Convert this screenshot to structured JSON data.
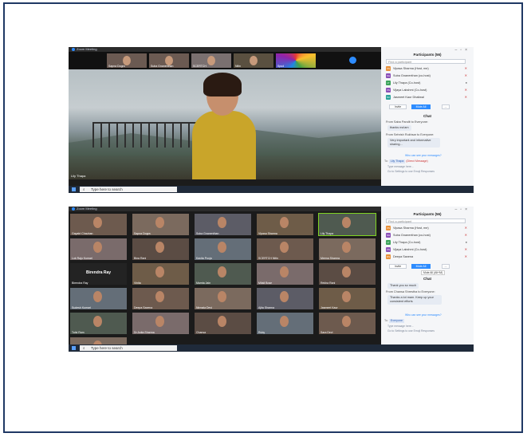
{
  "zoom_title": "Zoom Meeting",
  "taskbar": {
    "search_placeholder": "Type here to search"
  },
  "screenshot1": {
    "strip_labels": [
      "Sapna Dogra",
      "Suba Gnanenthan",
      "SCERTCH",
      "Nitin",
      "Spud"
    ],
    "speaker_label": "Lily Thapa",
    "participants_title": "Participants (56)",
    "find_placeholder": "Find a participant",
    "participants": [
      {
        "initials": "VS",
        "name": "Vipasa Sharma (Host, me)",
        "color": "#e8913a"
      },
      {
        "initials": "SG",
        "name": "Suba Gnanenthan (co-host)",
        "color": "#8a4fb8"
      },
      {
        "initials": "LT",
        "name": "Lily Thapa (Co-host)",
        "color": "#3aa35a"
      },
      {
        "initials": "VS",
        "name": "Vijaya Lakshmi (Co-host)",
        "color": "#8a4fb8"
      },
      {
        "initials": "SU",
        "name": "Jasmeet Kaur Dhaliwal",
        "color": "#2aa39a"
      }
    ],
    "buttons": {
      "invite": "Invite",
      "mute_all": "Mute All",
      "more": "..."
    },
    "chat_title": "Chat",
    "chat": [
      {
        "from": "From Saba Pandit to Everyone:",
        "text": "thanks ma'am"
      },
      {
        "from": "From Sehrish Rukhsar to Everyone:",
        "text": "Very important and informative sharing..."
      }
    ],
    "who_can_see": "Who can see your messages?",
    "to_label": "To:",
    "to_value": "Lily Thapa",
    "direct_message": "(Direct Message)",
    "input_hint": "Type message here...",
    "settings_hint": "Go to Settings to use Emoji Responses"
  },
  "screenshot2": {
    "participants_title": "Participants (56)",
    "find_placeholder": "Find a participant",
    "participants": [
      {
        "initials": "VS",
        "name": "Vipasa Sharma (Host, me)",
        "color": "#e8913a"
      },
      {
        "initials": "SG",
        "name": "Suba Gnanenthan (co-host)",
        "color": "#8a4fb8"
      },
      {
        "initials": "LT",
        "name": "Lily Thapa (Co-host)",
        "color": "#3aa35a"
      },
      {
        "initials": "VS",
        "name": "Vijaya Lakshmi (Co-host)",
        "color": "#8a4fb8"
      },
      {
        "initials": "DS",
        "name": "Deepa Saxena",
        "color": "#e8913a"
      }
    ],
    "buttons": {
      "invite": "Invite",
      "mute_all": "Mute All",
      "more": "..."
    },
    "mute_tooltip": "Mute All (Alt+M)",
    "chat_title": "Chat",
    "chat": [
      {
        "from": "",
        "text": "Thank you so much"
      },
      {
        "from": "From Chansa Shrestha to Everyone:",
        "text": "Thanks a lot mam. Keep up your consistent efforts"
      }
    ],
    "who_can_see": "Who can see your messages?",
    "to_label": "To:",
    "to_value": "Everyone",
    "input_hint": "Type message here...",
    "settings_hint": "Go to Settings to use Emoji Responses",
    "tiles": [
      {
        "name": "Gayatri Chauhan",
        "kind": "video"
      },
      {
        "name": "Sapna Dogra",
        "kind": "video"
      },
      {
        "name": "Suba Gnanenthan",
        "kind": "video"
      },
      {
        "name": "Vipasa Sharma",
        "kind": "video"
      },
      {
        "name": "Lily Thapa",
        "kind": "video",
        "active": true
      },
      {
        "name": "Lok Raju Kumari",
        "kind": "video"
      },
      {
        "name": "Bina Rani",
        "kind": "video"
      },
      {
        "name": "Kavita Pooja",
        "kind": "video"
      },
      {
        "name": "SCERTCH Nitin",
        "kind": "video"
      },
      {
        "name": "Meena Sharma",
        "kind": "video"
      },
      {
        "name": "Birendra Ray",
        "kind": "name"
      },
      {
        "name": "Vinita",
        "kind": "video"
      },
      {
        "name": "Mamta Jain",
        "kind": "video"
      },
      {
        "name": "Mitali Bose",
        "kind": "video"
      },
      {
        "name": "Rekha Rani",
        "kind": "video"
      },
      {
        "name": "Sudesh Kumari",
        "kind": "video"
      },
      {
        "name": "Deepa Saxena",
        "kind": "video"
      },
      {
        "name": "Nirmala Devi",
        "kind": "video"
      },
      {
        "name": "Ajita Sharma",
        "kind": "video"
      },
      {
        "name": "Jasmeet Kaur",
        "kind": "video"
      },
      {
        "name": "Tulsi Ram",
        "kind": "video"
      },
      {
        "name": "Dr Anita Sharma",
        "kind": "video"
      },
      {
        "name": "Chansa",
        "kind": "video"
      },
      {
        "name": "Ruby",
        "kind": "video"
      },
      {
        "name": "Sara Devi",
        "kind": "video"
      },
      {
        "name": "Sonia",
        "kind": "video"
      }
    ]
  },
  "colors": {
    "zoom_blue": "#2d8cff",
    "active_speaker": "#7fd321",
    "frame": "#1f3864"
  }
}
